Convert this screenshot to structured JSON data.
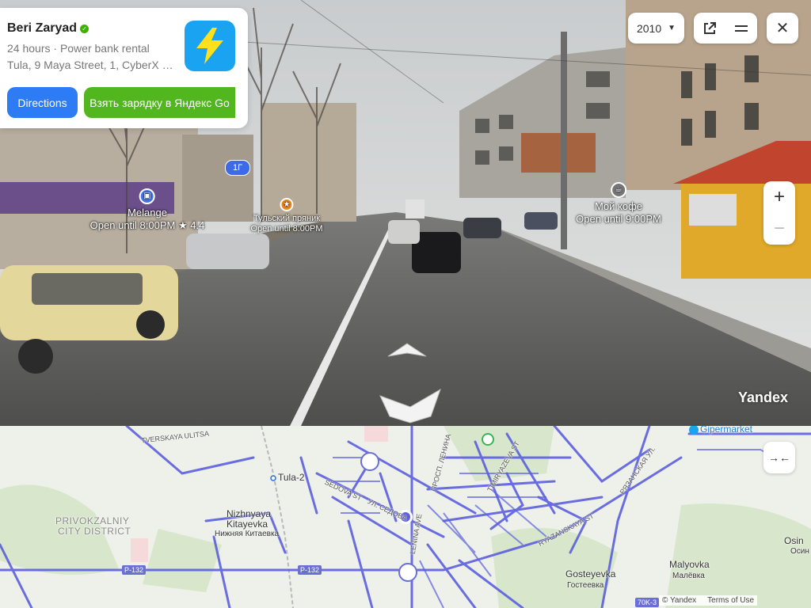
{
  "place": {
    "name": "Beri Zaryad",
    "hours": "24 hours",
    "separator": "·",
    "category": "Power bank rental",
    "address": "Tula, 9 Maya Street, 1, CyberX C...",
    "directions_label": "Directions",
    "go_label": "Взять зарядку в Яндекс Go"
  },
  "controls": {
    "year": "2010",
    "zoom_in": "+",
    "zoom_out": "−",
    "close": "✕"
  },
  "pano": {
    "route_badge": "1Г",
    "watermark": "Yandex",
    "pois": [
      {
        "name": "Melange",
        "status": "Open until 8:00PM",
        "rating": "★ 4.4"
      },
      {
        "name": "Тульский пряник",
        "status": "Open until 8:00PM"
      },
      {
        "name": "Мой кофе",
        "status": "Open until 9:00PM"
      }
    ]
  },
  "map": {
    "labels": {
      "tula2": "Tula-2",
      "nizh_en": "Nizhnyaya",
      "nizh_en2": "Kitayevka",
      "nizh_ru": "Нижняя Китаевка",
      "district1": "PRIVOKZALNIY",
      "district2": "CITY DISTRICT",
      "gost_en": "Gosteyevka",
      "gost_ru": "Гостеевка",
      "malo_en": "Malyovka",
      "malo_ru": "Малёвка",
      "osin_en": "Osin",
      "osin_ru": "Осин",
      "gipermarket": "Gipermarket",
      "tverskaya": "TVERSKAYA ULITSA",
      "sedova": "SEDOVA ST",
      "ul_sedova": "УЛ. СЕДОВА",
      "lenina": "LENINA AVE",
      "prosp_lenina": "ПРОСП. ЛЕНИНА",
      "timiryazeva": "TIMIRYAZEVA ST",
      "ryazanskaya": "RYAZANSKAYA ST",
      "ryazanskaya_ru": "РЯЗАНСКАЯ УЛ.",
      "r132a": "P-132",
      "r132b": "P-132",
      "r70k": "70K-3"
    },
    "copyright": "© Yandex",
    "terms": "Terms of Use"
  },
  "colors": {
    "route_blue": "#5b5fe0",
    "go_green": "#52b61f",
    "directions_blue": "#2d7cf5",
    "logo_blue": "#1aa3f0"
  }
}
